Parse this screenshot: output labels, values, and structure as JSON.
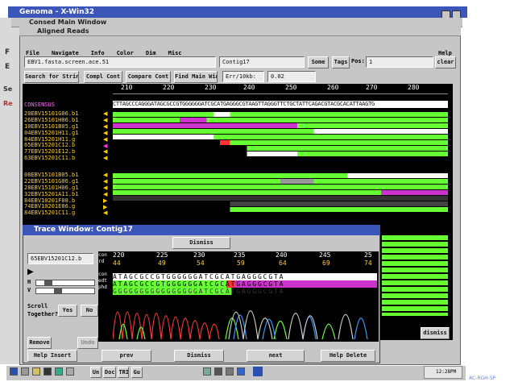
{
  "xwin_title": "Genoma - X-Win32",
  "consed_window_title": "Consed Main Window",
  "aligned_window_title": "Aligned Reads",
  "menu": [
    "File",
    "Navigate",
    "Info",
    "Color",
    "Dim",
    "Misc"
  ],
  "menu_help": "Help",
  "toolbar": {
    "file_field": "EBV1.fasta.screen.ace.51",
    "contig_field": "Contig17",
    "some_label": "Some",
    "tags_label": "Tags",
    "pos_label": "Pos:",
    "pos_value": "1",
    "clear_label": "clear",
    "search_label": "Search for String",
    "compl_label": "Compl Cont",
    "compare_label": "Compare Cont",
    "find_main_label": "Find Main Win",
    "err_label": "Err/10kb:",
    "err_value": "0.02"
  },
  "ruler_ticks": [
    "210",
    "220",
    "230",
    "240",
    "250",
    "260",
    "270",
    "280"
  ],
  "consensus_label": "CONSENSUS",
  "consensus_seq": "CTTAGCCCAGGGATAGCGCCGTGGGGGGATCGCATGAGGGCGTAAGTTAGGGTTCTGCTATTCAGACGTACGCACATTAAGTG",
  "reads_group1": [
    "20EBV15101G06.b1",
    "26EBV15101H06.b1",
    "10EBV15101B05.g1",
    "04EBV15201H11.g1",
    "84EBV15201H11.g",
    "65EBV15201C12.b",
    "77EBV15201E12.b",
    "63EBV15201C11.b"
  ],
  "reads_group2": [
    "08EBV15101B05.b1",
    "22EBV15101G06.g1",
    "28EBV15101H06.g1",
    "32EBV15201A11.b1",
    "84EBV10201F08.b",
    "74EBV10201E06.g",
    "84EBV15201C11.g"
  ],
  "trace_window": {
    "title": "Trace Window: Contig17",
    "dismiss_label": "Dismiss",
    "read_name": "65EBV15201C12.b",
    "con_ticks": [
      "220",
      "225",
      "230",
      "235",
      "240",
      "245",
      "25"
    ],
    "rd_ticks": [
      "44",
      "49",
      "54",
      "59",
      "64",
      "69",
      "74"
    ],
    "row_labels": [
      "con",
      "rd",
      "con",
      "edt",
      "phd"
    ],
    "con_seq": "ATAGCGCCGTGGGGGGATCGCATGAGGGCGTA",
    "edt_seq": "ATAGCGCCGTGGGGGGAtCGCATGAGGGCGTA",
    "phd_seq": "GGGGGGGGGGGGGGGGATCGCATGAGGGCGTA",
    "h_label": "H",
    "v_label": "V",
    "scroll_label": "Scroll",
    "together_label": "Together?",
    "yes_label": "Yes",
    "no_label": "No",
    "remove_label": "Remove",
    "undo_label": "Undo",
    "help_insert_label": "Help Insert",
    "prev_label": "prev",
    "dismiss2_label": "Dismiss",
    "next_label": "next",
    "help_delete_label": "Help Delete"
  },
  "right_panel_dismiss": "dismiss",
  "taskbar": {
    "items": [
      "Un",
      "Doc",
      "TRI",
      "Gu"
    ],
    "clock": "12:28PM"
  },
  "watermark": "AC-RGH-SP",
  "colors": {
    "title_blue": "#3b55b8",
    "window_grey": "#c6c6c6",
    "consensus_text": "#ff66ff",
    "read_name_text": "#ffcc33",
    "high_quality": "#66ff33",
    "low_quality": "#ffffff",
    "tag_magenta": "#cc33cc"
  },
  "icons": [
    "restore-icon",
    "close-icon",
    "arrow-icon",
    "start-icon"
  ]
}
